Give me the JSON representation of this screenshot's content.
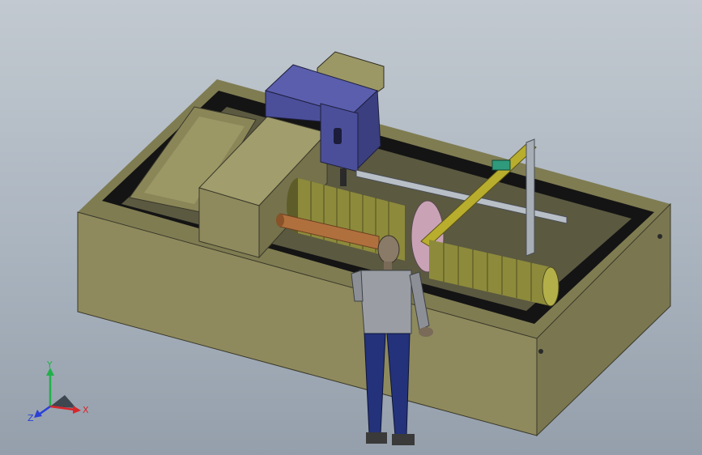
{
  "viewport": {
    "background_top": "#c2c9d0",
    "background_bottom": "#949fab"
  },
  "model_colors": {
    "enclosure": "#8e8a5d",
    "enclosure_dark": "#6a6744",
    "cavity": "#141414",
    "head_unit": "#4b4f9a",
    "coil": "#8d8b3b",
    "roller": "#b0703e",
    "gantry": "#b8ad2d",
    "figure_torso": "#9a9ea4",
    "figure_legs": "#23327a"
  },
  "triad": {
    "x_label": "X",
    "y_label": "Y",
    "z_label": "Z",
    "x_color": "#d8262b",
    "y_color": "#22b04b",
    "z_color": "#2a3fd6"
  }
}
